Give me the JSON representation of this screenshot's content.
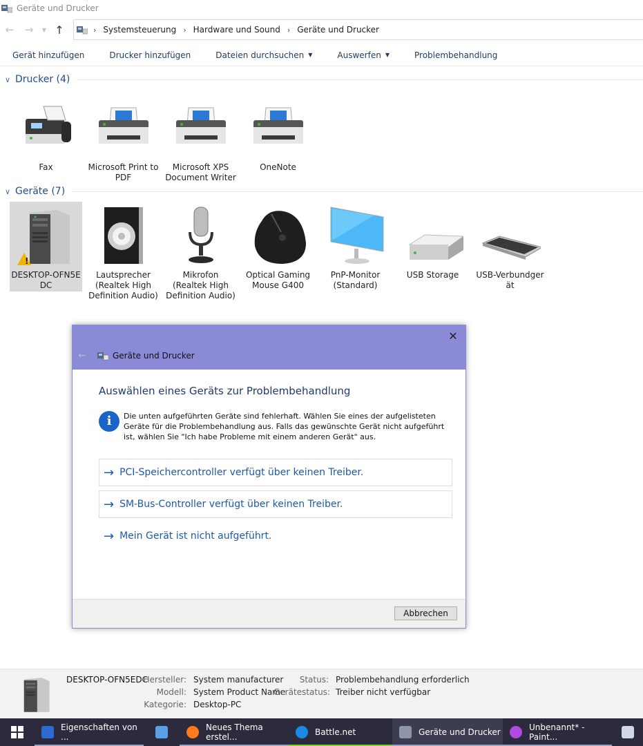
{
  "window": {
    "title": "Geräte und Drucker"
  },
  "address": {
    "breadcrumbs": [
      "Systemsteuerung",
      "Hardware und Sound",
      "Geräte und Drucker"
    ]
  },
  "commands": {
    "add_device": "Gerät hinzufügen",
    "add_printer": "Drucker hinzufügen",
    "browse_files": "Dateien durchsuchen",
    "eject": "Auswerfen",
    "troubleshoot": "Problembehandlung"
  },
  "printers": {
    "title": "Drucker (4)",
    "items": [
      {
        "label": "Fax"
      },
      {
        "label": "Microsoft Print to PDF"
      },
      {
        "label": "Microsoft XPS Document Writer"
      },
      {
        "label": "OneNote"
      }
    ]
  },
  "devices": {
    "title": "Geräte (7)",
    "items": [
      {
        "label": "DESKTOP-OFN5EDC"
      },
      {
        "label": "Lautsprecher (Realtek High Definition Audio)"
      },
      {
        "label": "Mikrofon (Realtek High Definition Audio)"
      },
      {
        "label": "Optical Gaming Mouse G400"
      },
      {
        "label": "PnP-Monitor (Standard)"
      },
      {
        "label": "USB Storage"
      },
      {
        "label": "USB-Verbundgerät"
      }
    ]
  },
  "dialog": {
    "title": "Geräte und Drucker",
    "heading": "Auswählen eines Geräts zur Problembehandlung",
    "info": "Die unten aufgeführten Geräte sind fehlerhaft. Wählen Sie eines der aufgelisteten Geräte für die Problembehandlung aus. Falls das gewünschte Gerät nicht aufgeführt ist, wählen Sie \"Ich habe Probleme mit einem anderen Gerät\" aus.",
    "options": [
      "PCI-Speichercontroller verfügt über keinen Treiber.",
      "SM-Bus-Controller verfügt über keinen Treiber.",
      "Mein Gerät ist nicht aufgeführt."
    ],
    "cancel": "Abbrechen"
  },
  "details": {
    "name": "DESKTOP-OFN5EDC",
    "manufacturer_label": "Hersteller:",
    "manufacturer": "System manufacturer",
    "model_label": "Modell:",
    "model": "System Product Name",
    "category_label": "Kategorie:",
    "category": "Desktop-PC",
    "status_label": "Status:",
    "status": "Problembehandlung erforderlich",
    "device_status_label": "Gerätestatus:",
    "device_status": "Treiber nicht verfügbar"
  },
  "taskbar": {
    "items": [
      {
        "label": "Eigenschaften von ..."
      },
      {
        "label": ""
      },
      {
        "label": "Neues Thema erstel..."
      },
      {
        "label": "Battle.net"
      },
      {
        "label": "Geräte und Drucker"
      },
      {
        "label": "Unbenannt* - Paint..."
      }
    ]
  },
  "colors": {
    "dialog_header": "#8a8ad6",
    "link_blue": "#1e5aa8",
    "heading_blue": "#1e4e8c",
    "warning": "#f2b400",
    "taskbar": "#2b2b3d"
  }
}
